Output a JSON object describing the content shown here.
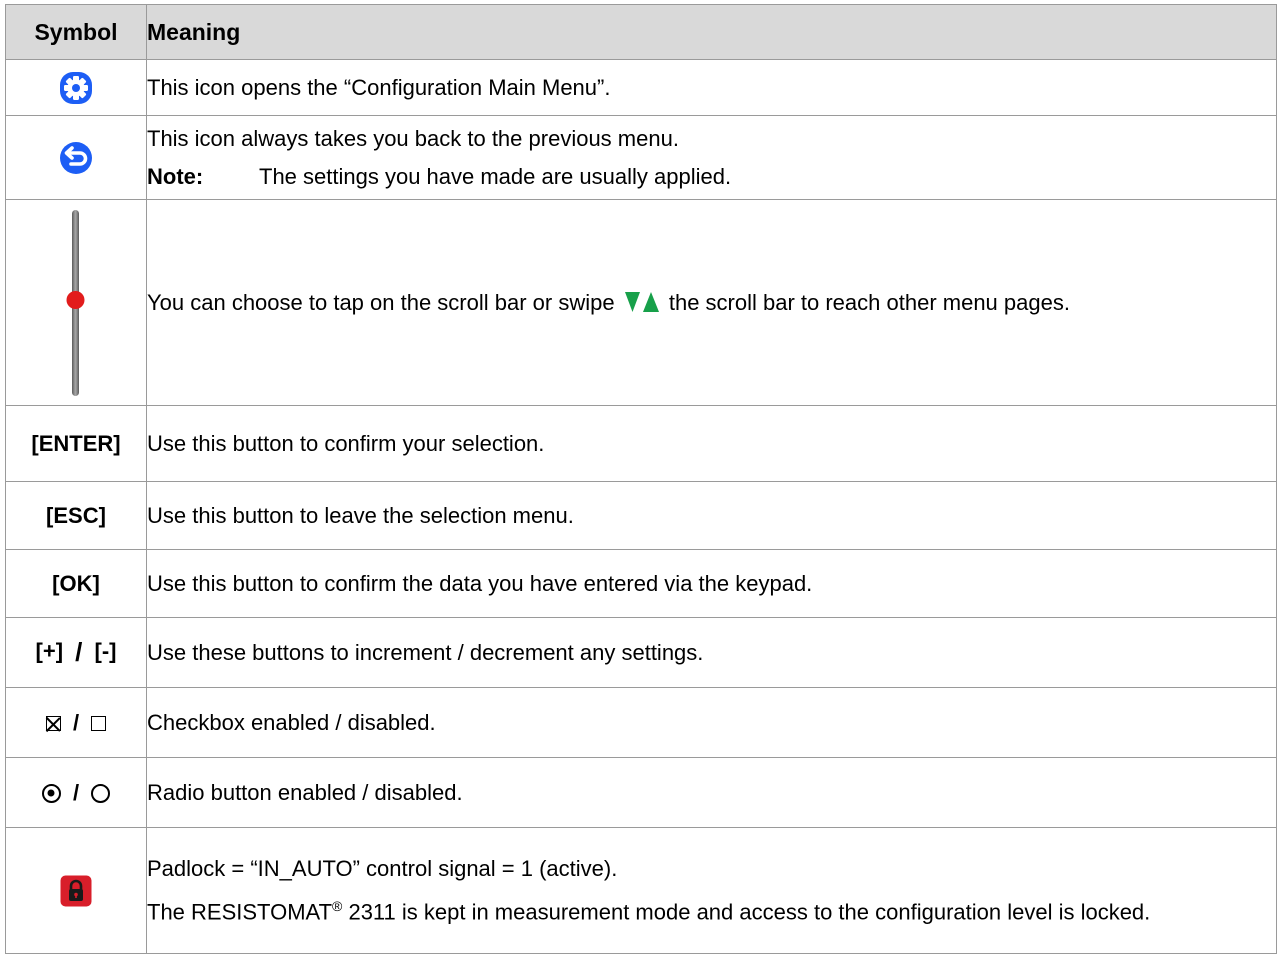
{
  "header": {
    "symbol": "Symbol",
    "meaning": "Meaning"
  },
  "rows": {
    "config": {
      "text": "This icon opens the “Configuration Main Menu”."
    },
    "back": {
      "text": "This icon always takes you back to the previous menu.",
      "note_label": "Note:",
      "note_text": "The settings you have made are usually applied."
    },
    "scroll": {
      "text_before": "You can choose to tap on the scroll bar or swipe",
      "text_after": "the scroll bar to reach other menu pages."
    },
    "enter": {
      "symbol": "[ENTER]",
      "text": "Use this button to confirm your selection."
    },
    "esc": {
      "symbol": "[ESC]",
      "text": "Use this button to leave the selection menu."
    },
    "ok": {
      "symbol": "[OK]",
      "text": "Use this button to confirm the data you have entered via the keypad."
    },
    "plusminus": {
      "symbol_plus": "[+]",
      "separator": "/",
      "symbol_minus": "[-]",
      "text": "Use these buttons to increment / decrement any settings."
    },
    "checkbox": {
      "separator": "/",
      "text": "Checkbox enabled / disabled."
    },
    "radio": {
      "separator": "/",
      "text": "Radio button enabled / disabled."
    },
    "padlock": {
      "text1": "Padlock = “IN_AUTO” control signal = 1 (active).",
      "text2_before": "The RESISTOMAT",
      "text2_reg": "®",
      "text2_after": " 2311 is kept in measurement mode and access to the configuration level is locked."
    }
  },
  "icons": {
    "config": "gear-icon",
    "back": "back-arrow-icon",
    "scroll": "scrollbar-icon",
    "swipe": "swipe-arrows-icon",
    "padlock": "padlock-icon"
  },
  "colors": {
    "icon_blue": "#1d5ef5",
    "swipe_green": "#17a04a",
    "scroll_red": "#e21c1c",
    "padlock_red": "#d81e2a",
    "header_bg": "#d9d9d9",
    "border": "#9a9a9a"
  }
}
